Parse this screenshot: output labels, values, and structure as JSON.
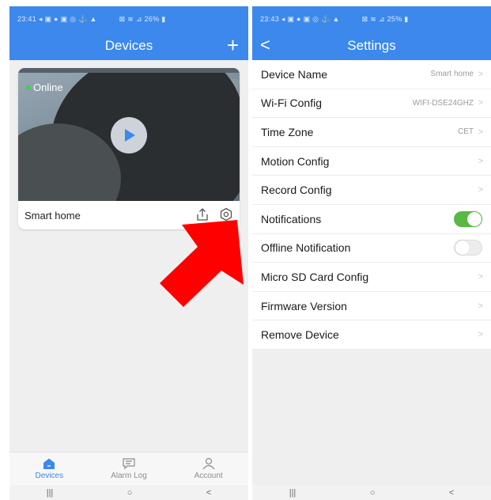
{
  "left": {
    "status": {
      "left": "23:41 ◂ ▣ ● ▣ ◎ ⚓ ▲",
      "right": "⊠ ≋ ⊿ 26% ▮"
    },
    "title": "Devices",
    "add_label": "+",
    "card": {
      "status": "Online",
      "name": "Smart home"
    },
    "tabs": [
      {
        "label": "Devices",
        "icon": "home-icon",
        "active": true
      },
      {
        "label": "Alarm Log",
        "icon": "alarm-log-icon",
        "active": false
      },
      {
        "label": "Account",
        "icon": "account-icon",
        "active": false
      }
    ],
    "nav": {
      "recent": "|||",
      "home": "○",
      "back": "<"
    }
  },
  "right": {
    "status": {
      "left": "23:43 ◂ ▣ ● ▣ ◎ ⚓ ▲",
      "right": "⊠ ≋ ⊿ 25% ▮"
    },
    "title": "Settings",
    "back": "<",
    "rows": [
      {
        "label": "Device Name",
        "value": "Smart home",
        "chev": ">"
      },
      {
        "label": "Wi-Fi Config",
        "value": "WIFI-DSE24GHZ",
        "chev": ">"
      },
      {
        "label": "Time Zone",
        "value": "CET",
        "chev": ">"
      },
      {
        "label": "Motion Config",
        "chev": ">"
      },
      {
        "label": "Record Config",
        "chev": ">"
      },
      {
        "label": "Notifications",
        "toggle": "on"
      },
      {
        "label": "Offline Notification",
        "toggle": "off"
      },
      {
        "label": "Micro SD Card Config",
        "chev": ">"
      },
      {
        "label": "Firmware Version",
        "chev": ">"
      },
      {
        "label": "Remove Device",
        "chev": ">"
      }
    ],
    "nav": {
      "recent": "|||",
      "home": "○",
      "back": "<"
    }
  },
  "colors": {
    "primary": "#3c88ec",
    "toggle_on": "#5ab845",
    "online_dot": "#3fd14a",
    "arrow": "#ff0000"
  }
}
